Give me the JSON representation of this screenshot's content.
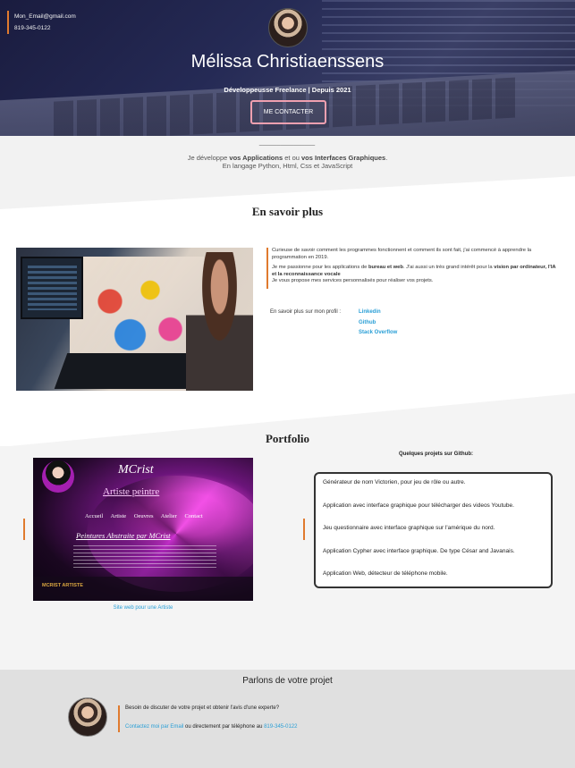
{
  "hero": {
    "email": "Mon_Email@gmail.com",
    "phone": "819-345-0122",
    "name": "Mélissa Christiaenssens",
    "subtitle": "Développeusse Freelance | Depuis 2021",
    "cta_label": "ME CONTACTER"
  },
  "intro": {
    "rule": "________________",
    "line1_prefix": "Je développe ",
    "line1_b1": "vos Applications",
    "line1_mid": " et ou ",
    "line1_b2": "vos Interfaces Graphiques",
    "line1_end": ".",
    "line2": "En langage Python, Html, Css et JavaScript"
  },
  "about": {
    "title": "En savoir plus",
    "p1": "Curieuse de savoir comment les programmes fonctionnent et comment ils sont fait, j'ai commencé à apprendre la programmation en 2019.",
    "p2_prefix": "Je me passionne pour les applications de ",
    "p2_b1": "bureau et web",
    "p2_mid": ". J'ai aussi un très grand intérêt pour la ",
    "p2_b2": "vision par ordinateur, l'IA et la reconnaissance vocale",
    "p3": "Je vous propose mes services personnalisés pour réaliser vos projets.",
    "profile_label": "En savoir plus sur mon profil :",
    "links": [
      "Linkedin",
      "Github",
      "Stack Overflow"
    ]
  },
  "portfolio": {
    "title": "Portfolio",
    "mcrist": {
      "title": "MCrist",
      "subtitle": "Artiste peintre",
      "nav": [
        "Accueil",
        "Artiste",
        "Oeuvres",
        "Atelier",
        "Contact"
      ],
      "heading": "Peintures Abstraite par MCrist",
      "logo": "MCRIST ARTISTE"
    },
    "site_link": "Site web pour une Artiste",
    "projects_heading": "Quelques projets sur Github:",
    "projects": [
      "Générateur de nom Victorien, pour jeu de rôle ou autre.",
      "Application avec interface graphique pour télécharger des videos Youtube.",
      "Jeu questionnaire avec interface graphique sur l'amérique du nord.",
      "Application Cypher avec interface graphique. De type César and Javanais.",
      "Application Web, détecteur de téléphone mobile."
    ]
  },
  "contact": {
    "title": "Parlons de votre projet",
    "question": "Besoin de discuter de votre projet et obtenir l'avis d'une experte?",
    "email_link": "Contactez moi par Email",
    "mid_text": " ou directement par téléphone au ",
    "phone_link": "819-345-0122"
  },
  "colors": {
    "accent_orange": "#e07a2e",
    "link_blue": "#2a9fd6",
    "cta_border": "#f0a0b0"
  }
}
